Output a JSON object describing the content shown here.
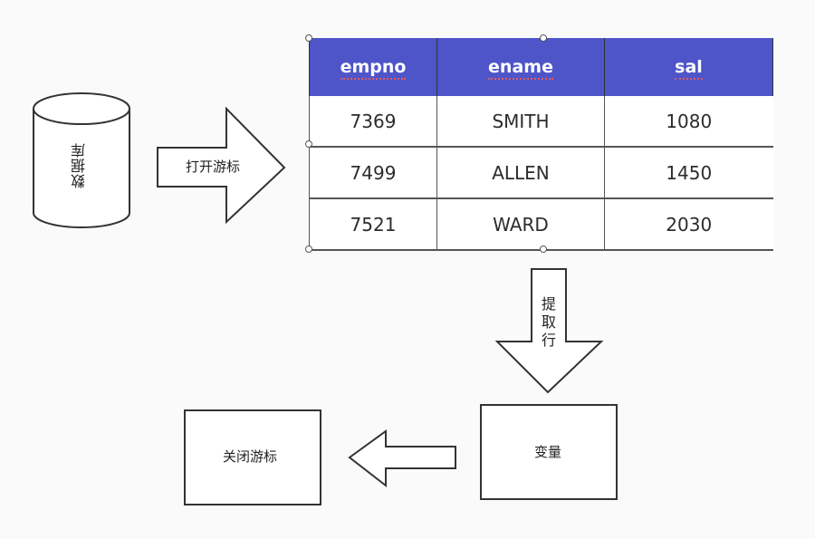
{
  "nodes": {
    "database": "数据库",
    "open_cursor": "打开游标",
    "fetch_row": [
      "提",
      "取",
      "行"
    ],
    "variable": "变量",
    "close_cursor": "关闭游标"
  },
  "table": {
    "headers": [
      "empno",
      "ename",
      "sal"
    ],
    "rows": [
      [
        "7369",
        "SMITH",
        "1080"
      ],
      [
        "7499",
        "ALLEN",
        "1450"
      ],
      [
        "7521",
        "WARD",
        "2030"
      ]
    ]
  },
  "colors": {
    "header_bg": "#4e55c9",
    "header_text": "#ffffff",
    "stroke": "#333333"
  }
}
